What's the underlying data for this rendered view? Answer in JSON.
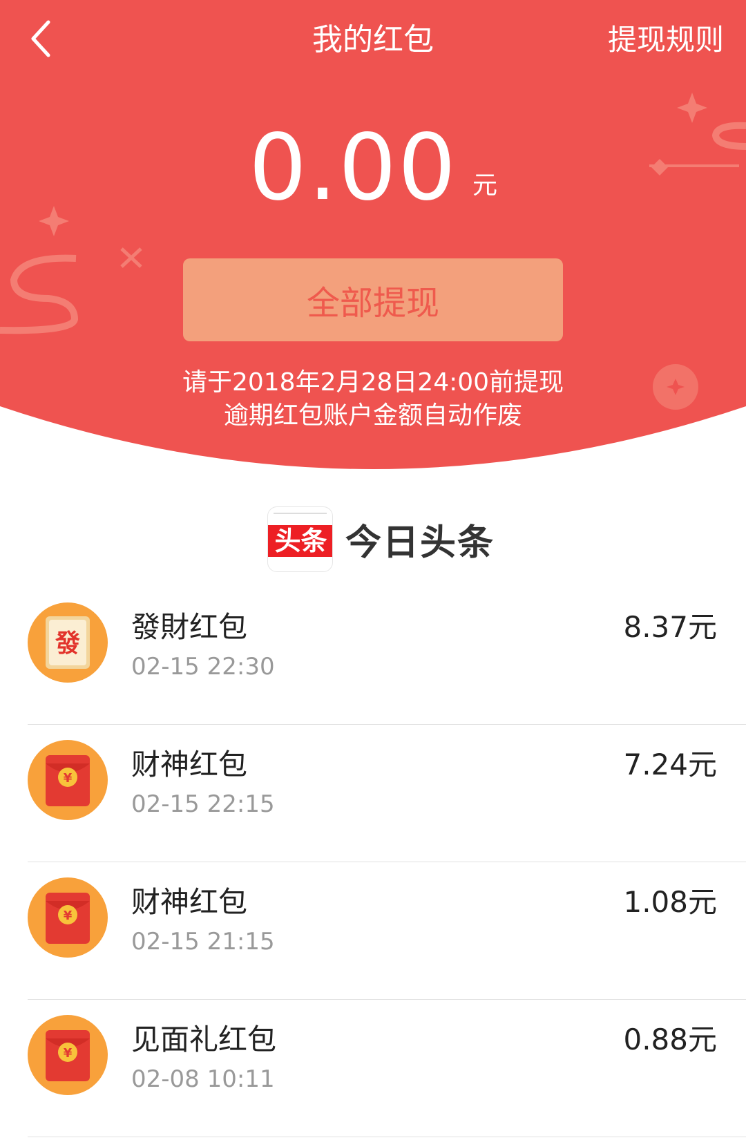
{
  "header": {
    "title": "我的红包",
    "rules_label": "提现规则",
    "balance": "0.00",
    "currency_unit": "元",
    "withdraw_label": "全部提现",
    "notice_line1": "请于2018年2月28日24:00前提现",
    "notice_line2": "逾期红包账户金额自动作废",
    "colors": {
      "hero_red": "#ef5350",
      "button_peach": "#f3a07c",
      "button_text": "#ef5a4d"
    }
  },
  "brand": {
    "logo_text": "头条",
    "name": "今日头条"
  },
  "packets": [
    {
      "name": "發財红包",
      "time": "02-15 22:30",
      "amount": "8.37元",
      "icon": "fa-cai-card-icon"
    },
    {
      "name": "财神红包",
      "time": "02-15 22:15",
      "amount": "7.24元",
      "icon": "red-envelope-icon"
    },
    {
      "name": "财神红包",
      "time": "02-15 21:15",
      "amount": "1.08元",
      "icon": "red-envelope-icon"
    },
    {
      "name": "见面礼红包",
      "time": "02-08 10:11",
      "amount": "0.88元",
      "icon": "red-envelope-icon"
    }
  ],
  "icon_glyphs": {
    "fa_char": "發",
    "yuan_symbol": "¥"
  }
}
